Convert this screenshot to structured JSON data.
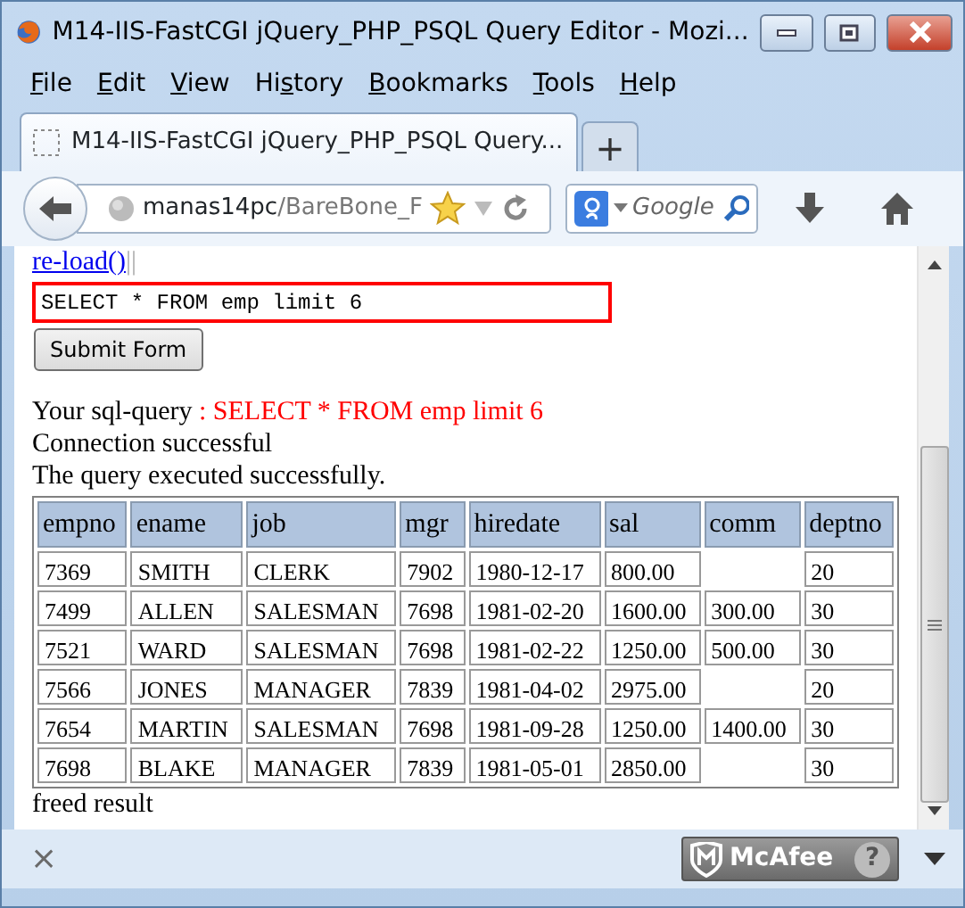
{
  "window": {
    "title": "M14-IIS-FastCGI jQuery_PHP_PSQL Query Editor - Mozi..."
  },
  "menu": [
    {
      "access_key": "F",
      "rest": "ile"
    },
    {
      "access_key": "E",
      "rest": "dit"
    },
    {
      "access_key": "V",
      "rest": "iew"
    },
    {
      "start": "Hi",
      "access_key": "s",
      "rest": "tory"
    },
    {
      "access_key": "B",
      "rest": "ookmarks"
    },
    {
      "access_key": "T",
      "rest": "ools"
    },
    {
      "access_key": "H",
      "rest": "elp"
    }
  ],
  "tabs": [
    {
      "label": "M14-IIS-FastCGI jQuery_PHP_PSQL Query...",
      "selected": true
    }
  ],
  "new_tab": "+",
  "address": {
    "host": "manas14pc",
    "path": "/BareBone_F"
  },
  "search": {
    "placeholder": "Google"
  },
  "page": {
    "reload_link": "re-load()",
    "separator": "||",
    "query_input": "SELECT * FROM emp limit 6",
    "submit": "Submit Form",
    "query_label": "Your sql-query",
    "query_echo": ": SELECT * FROM emp limit 6",
    "messages": [
      "Connection successful",
      "The query executed successfully."
    ],
    "table": {
      "columns": [
        "empno",
        "ename",
        "job",
        "mgr",
        "hiredate",
        "sal",
        "comm",
        "deptno"
      ],
      "rows": [
        [
          "7369",
          "SMITH",
          "CLERK",
          "7902",
          "1980-12-17",
          "800.00",
          null,
          "20"
        ],
        [
          "7499",
          "ALLEN",
          "SALESMAN",
          "7698",
          "1981-02-20",
          "1600.00",
          "300.00",
          "30"
        ],
        [
          "7521",
          "WARD",
          "SALESMAN",
          "7698",
          "1981-02-22",
          "1250.00",
          "500.00",
          "30"
        ],
        [
          "7566",
          "JONES",
          "MANAGER",
          "7839",
          "1981-04-02",
          "2975.00",
          null,
          "20"
        ],
        [
          "7654",
          "MARTIN",
          "SALESMAN",
          "7698",
          "1981-09-28",
          "1250.00",
          "1400.00",
          "30"
        ],
        [
          "7698",
          "BLAKE",
          "MANAGER",
          "7839",
          "1981-05-01",
          "2850.00",
          null,
          "30"
        ]
      ]
    },
    "footer_text": "freed result"
  },
  "status_bar": {
    "close": "×",
    "addon": "McAfee",
    "help": "?"
  }
}
